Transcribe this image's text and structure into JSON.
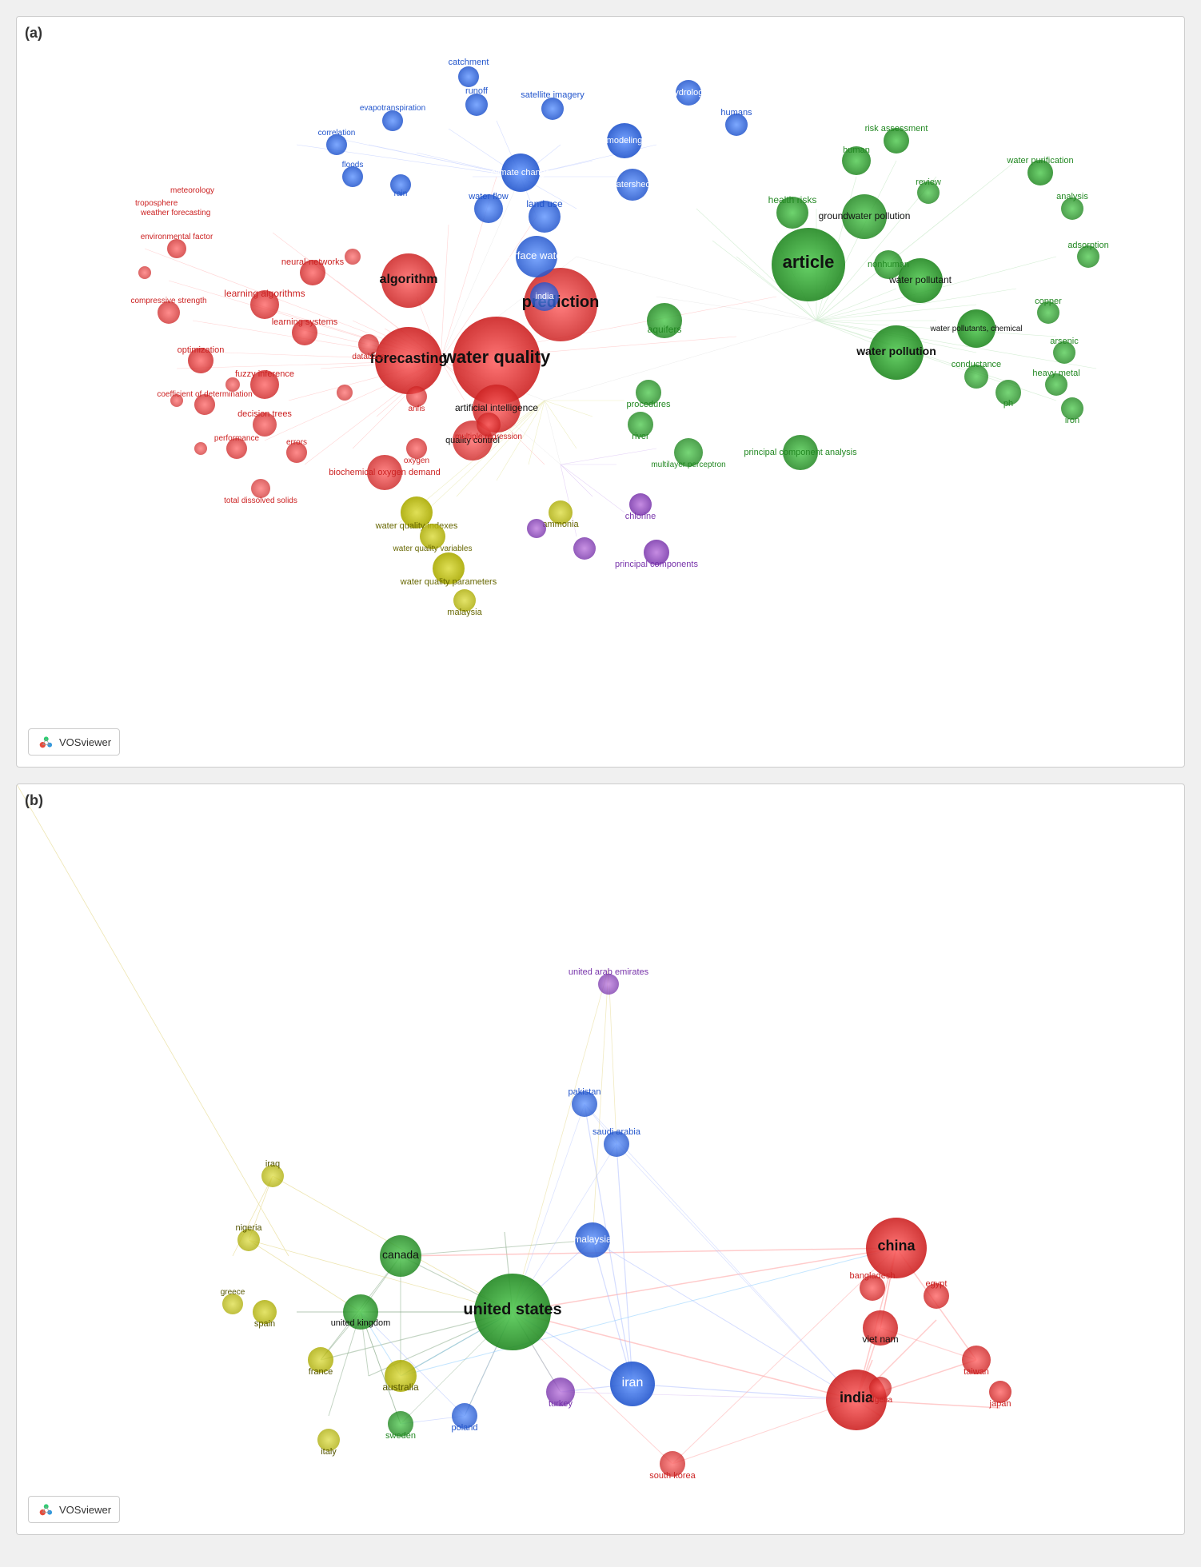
{
  "panels": [
    {
      "label": "(a)",
      "vos_text": "VOSviewer",
      "type": "keyword_network"
    },
    {
      "label": "(b)",
      "vos_text": "VOSviewer",
      "type": "country_network"
    }
  ]
}
